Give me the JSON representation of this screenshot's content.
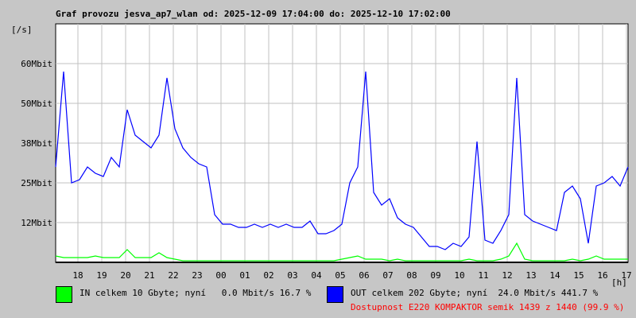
{
  "chart_data": {
    "type": "line",
    "title": "Graf provozu jesva_ap7_wlan od: 2025-12-09 17:04:00 do: 2025-12-10 17:02:00",
    "ylabel": "[/s]",
    "xlabel": "[h]",
    "ylim": [
      0,
      75
    ],
    "yticks": [
      {
        "v": 12.5,
        "label": "12Mbit"
      },
      {
        "v": 25,
        "label": "25Mbit"
      },
      {
        "v": 37.5,
        "label": "38Mbit"
      },
      {
        "v": 50,
        "label": "50Mbit"
      },
      {
        "v": 62.5,
        "label": "60Mbit"
      }
    ],
    "xlim_minutes": [
      0,
      1440
    ],
    "xticks": [
      "18",
      "19",
      "20",
      "21",
      "22",
      "23",
      "00",
      "01",
      "02",
      "03",
      "04",
      "05",
      "06",
      "07",
      "08",
      "09",
      "10",
      "11",
      "12",
      "13",
      "14",
      "15",
      "16",
      "17"
    ],
    "sample_step_minutes": 20,
    "series": [
      {
        "name": "OUT",
        "color": "#0000ff",
        "values": [
          30,
          60,
          25,
          26,
          30,
          28,
          27,
          33,
          30,
          48,
          40,
          38,
          36,
          40,
          58,
          42,
          36,
          33,
          31,
          30,
          15,
          12,
          12,
          11,
          11,
          12,
          11,
          12,
          11,
          12,
          11,
          11,
          13,
          9,
          9,
          10,
          12,
          25,
          30,
          60,
          22,
          18,
          20,
          14,
          12,
          11,
          8,
          5,
          5,
          4,
          6,
          5,
          8,
          38,
          7,
          6,
          10,
          15,
          58,
          15,
          13,
          12,
          11,
          10,
          22,
          24,
          20,
          6,
          24,
          25,
          27,
          24,
          30
        ]
      },
      {
        "name": "IN",
        "color": "#00ff00",
        "values": [
          2,
          1.5,
          1.5,
          1.5,
          1.5,
          2,
          1.5,
          1.5,
          1.5,
          4,
          1.5,
          1.5,
          1.5,
          3,
          1.5,
          1,
          0.5,
          0.5,
          0.5,
          0.5,
          0.5,
          0.5,
          0.5,
          0.5,
          0.5,
          0.5,
          0.5,
          0.5,
          0.5,
          0.5,
          0.5,
          0.5,
          0.5,
          0.5,
          0.5,
          0.5,
          1,
          1.5,
          2,
          1,
          1,
          1,
          0.5,
          1,
          0.5,
          0.5,
          0.5,
          0.5,
          0.5,
          0.5,
          0.5,
          0.5,
          1,
          0.5,
          0.5,
          0.5,
          1,
          2,
          6,
          1,
          0.5,
          0.5,
          0.5,
          0.5,
          0.5,
          1,
          0.5,
          1,
          2,
          1,
          1,
          1,
          1
        ]
      }
    ]
  },
  "legend": {
    "in_text": "IN celkem 10 Gbyte; nyní   0.0 Mbit/s 16.7 %",
    "out_text": "OUT celkem 202 Gbyte; nyní  24.0 Mbit/s 441.7 %",
    "availability": "Dostupnost E220 KOMPAKTOR semik 1439 z 1440 (99.9 %)",
    "in_color": "#00ff00",
    "out_color": "#0000ff",
    "availability_color": "#ff0000"
  }
}
